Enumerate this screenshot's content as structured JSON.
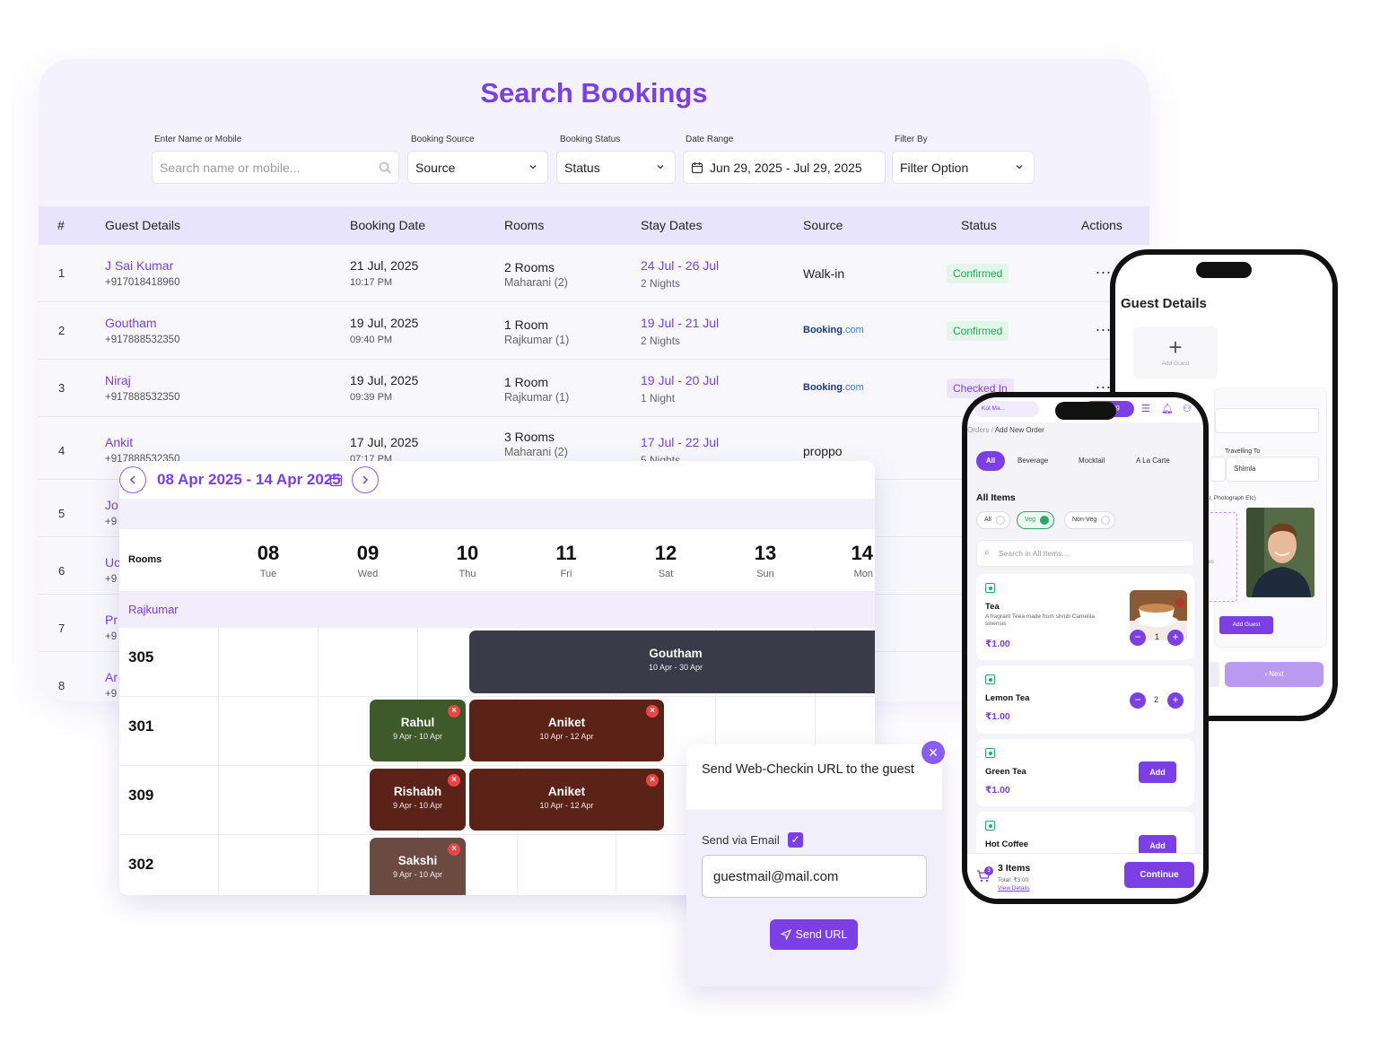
{
  "search": {
    "title": "Search Bookings",
    "name_label": "Enter Name or Mobile",
    "name_placeholder": "Search name or mobile...",
    "source_label": "Booking Source",
    "source_value": "Source",
    "status_label": "Booking Status",
    "status_value": "Status",
    "date_label": "Date Range",
    "date_value": "Jun 29, 2025 - Jul 29, 2025",
    "filter_label": "Filter By",
    "filter_value": "Filter Option"
  },
  "table": {
    "headers": [
      "#",
      "Guest Details",
      "Booking Date",
      "Rooms",
      "Stay Dates",
      "Source",
      "Status",
      "Actions"
    ],
    "rows": [
      {
        "idx": "1",
        "name": "J Sai Kumar",
        "phone": "+917018418960",
        "date": "21 Jul, 2025",
        "time": "10:17 PM",
        "rooms": "2 Rooms",
        "room_detail": "Maharani (2)",
        "stay": "24 Jul - 26 Jul",
        "nights": "2 Nights",
        "source": "Walk-in",
        "status": "Confirmed",
        "actions": "..."
      },
      {
        "idx": "2",
        "name": "Goutham",
        "phone": "+917888532350",
        "date": "19 Jul, 2025",
        "time": "09:40 PM",
        "rooms": "1 Room",
        "room_detail": "Rajkumar (1)",
        "stay": "19 Jul - 21 Jul",
        "nights": "2 Nights",
        "source_a": "Booking",
        "source_b": ".com",
        "status": "Confirmed",
        "actions": "..."
      },
      {
        "idx": "3",
        "name": "Niraj",
        "phone": "+917888532350",
        "date": "19 Jul, 2025",
        "time": "09:39 PM",
        "rooms": "1 Room",
        "room_detail": "Rajkumar (1)",
        "stay": "19 Jul - 20 Jul",
        "nights": "1 Night",
        "source_a": "Booking",
        "source_b": ".com",
        "status": "Checked In",
        "actions": "..."
      },
      {
        "idx": "4",
        "name": "Ankit",
        "phone": "+917888532350",
        "date": "17 Jul, 2025",
        "time": "07:17 PM",
        "rooms": "3 Rooms",
        "room_detail": "Maharani (2)",
        "stay": "17 Jul - 22 Jul",
        "nights": "5 Nights",
        "source": "proppo"
      },
      {
        "idx": "5",
        "name": "Jo",
        "phone": "+9"
      },
      {
        "idx": "6",
        "name": "Uc",
        "phone": "+9"
      },
      {
        "idx": "7",
        "name": "Pr",
        "phone": "+9"
      },
      {
        "idx": "8",
        "name": "Ar",
        "phone": "+9"
      }
    ]
  },
  "calendar": {
    "range": "08 Apr 2025 - 14 Apr 2025",
    "rooms_label": "Rooms",
    "days": [
      {
        "num": "08",
        "wd": "Tue"
      },
      {
        "num": "09",
        "wd": "Wed"
      },
      {
        "num": "10",
        "wd": "Thu"
      },
      {
        "num": "11",
        "wd": "Fri"
      },
      {
        "num": "12",
        "wd": "Sat"
      },
      {
        "num": "13",
        "wd": "Sun"
      },
      {
        "num": "14",
        "wd": "Mon"
      }
    ],
    "group": "Rajkumar",
    "rooms": [
      "305",
      "301",
      "309",
      "302"
    ],
    "bookings": [
      {
        "name": "Goutham",
        "dates": "10 Apr - 30 Apr",
        "color": "#3a3a48"
      },
      {
        "name": "Rahul",
        "dates": "9 Apr - 10 Apr",
        "color": "#3f5a2a"
      },
      {
        "name": "Aniket",
        "dates": "10 Apr - 12 Apr",
        "color": "#5b2218"
      },
      {
        "name": "Rishabh",
        "dates": "9 Apr - 10 Apr",
        "color": "#5b2218"
      },
      {
        "name": "Aniket",
        "dates": "10 Apr - 12 Apr",
        "color": "#5b2218"
      },
      {
        "name": "Sakshi",
        "dates": "9 Apr - 10 Apr",
        "color": "#6b4a42"
      }
    ]
  },
  "modal": {
    "title": "Send Web-Checkin URL to the guest",
    "via_label": "Send via Email",
    "email": "guestmail@mail.com",
    "send_label": "Send URL"
  },
  "phone1": {
    "title": "Guest Details",
    "add_guest_tile": "Add Guest",
    "travelling_label": "Travelling To",
    "travelling_value": "Shimla",
    "docs_label": "dhaar, Photograph Etc)",
    "upload_hint": "ages",
    "add_guest_btn": "Add Guest",
    "next_btn": "› Next"
  },
  "phone2": {
    "kot": "Kot Ma...",
    "pill": "ng",
    "crumb_a": "Orders",
    "crumb_sep": "/",
    "crumb_b": "Add New Order",
    "tabs": [
      "All",
      "Beverage",
      "Mocktail",
      "A La Carte"
    ],
    "all_items": "All Items",
    "chips": [
      "All",
      "Veg",
      "Non-Veg"
    ],
    "search_placeholder": "Search in All Items...",
    "items": [
      {
        "name": "Tea",
        "desc": "A fragrant Teea made from shrub Camellia sinensis",
        "price": "₹1.00",
        "qty": "1"
      },
      {
        "name": "Lemon Tea",
        "price": "₹1.00",
        "qty": "2"
      },
      {
        "name": "Green Tea",
        "price": "₹1.00",
        "add": "Add"
      },
      {
        "name": "Hot Coffee",
        "add": "Add"
      }
    ],
    "cart_count": "3",
    "cart_items": "3 Items",
    "cart_total": "Total: ₹3.00",
    "view_details": "View Details",
    "continue": "Continue"
  },
  "colors": {
    "accent": "#7b3fe4",
    "confirmed": "#1fa55a",
    "panel_bg": "#f4f3fd"
  }
}
